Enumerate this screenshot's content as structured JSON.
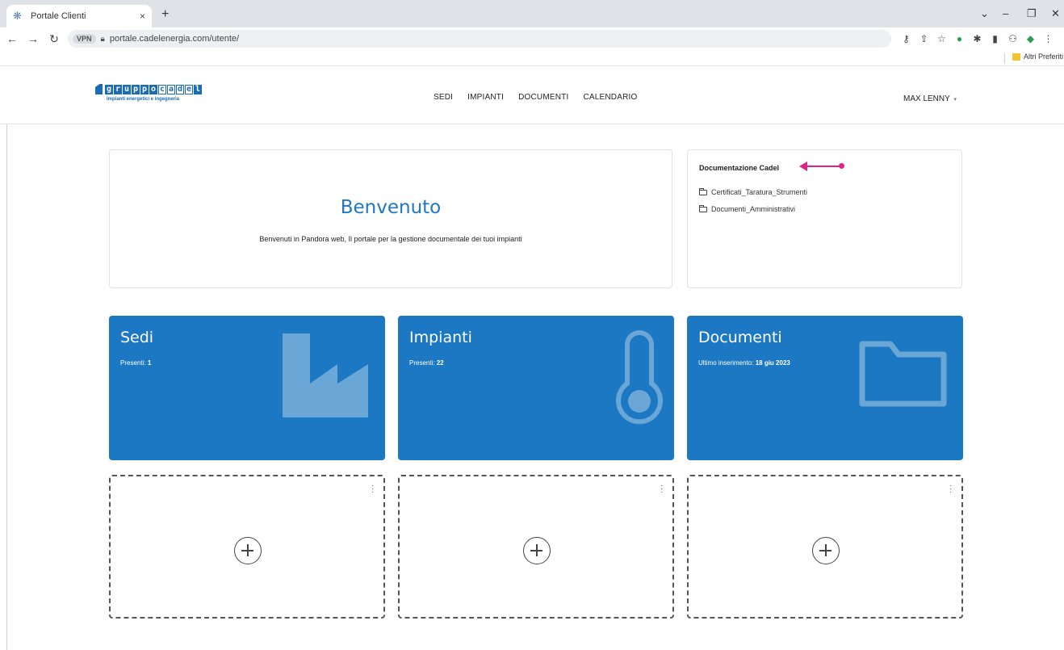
{
  "browser": {
    "tab_title": "Portale Clienti",
    "tab_close": "×",
    "new_tab": "+",
    "url": "portale.cadelenergia.com/utente/",
    "vpn_label": "VPN",
    "bookmark_folder": "Altri Preferiti"
  },
  "logo": {
    "letters": [
      "g",
      "r",
      "u",
      "p",
      "p",
      "o",
      "c",
      "a",
      "d",
      "e",
      "l"
    ],
    "subtitle": "Impianti energetici e ingegneria",
    "brand_color": "#1a6db5"
  },
  "nav": {
    "items": [
      "SEDI",
      "IMPIANTI",
      "DOCUMENTI",
      "CALENDARIO"
    ],
    "user": "MAX LENNY",
    "caret": "▾"
  },
  "welcome": {
    "title": "Benvenuto",
    "text": "Benvenuti in Pandora web, Il portale per la gestione documentale dei tuoi impianti"
  },
  "docs": {
    "title": "Documentazione Cadel",
    "folders": [
      "Certificati_Taratura_Strumenti",
      "Documenti_Amministrativi"
    ]
  },
  "tiles": [
    {
      "title": "Sedi",
      "stat_label": "Presenti:",
      "stat_value": "1",
      "icon": "factory-icon"
    },
    {
      "title": "Impianti",
      "stat_label": "Presenti:",
      "stat_value": "22",
      "icon": "thermometer-icon"
    },
    {
      "title": "Documenti",
      "stat_label": "Ultimo inserimento:",
      "stat_value": "18 giu 2023",
      "icon": "folder-icon"
    }
  ],
  "colors": {
    "tile": "#1c78c2",
    "accent": "#1f78c1",
    "annotation_arrow": "#e0218a"
  }
}
